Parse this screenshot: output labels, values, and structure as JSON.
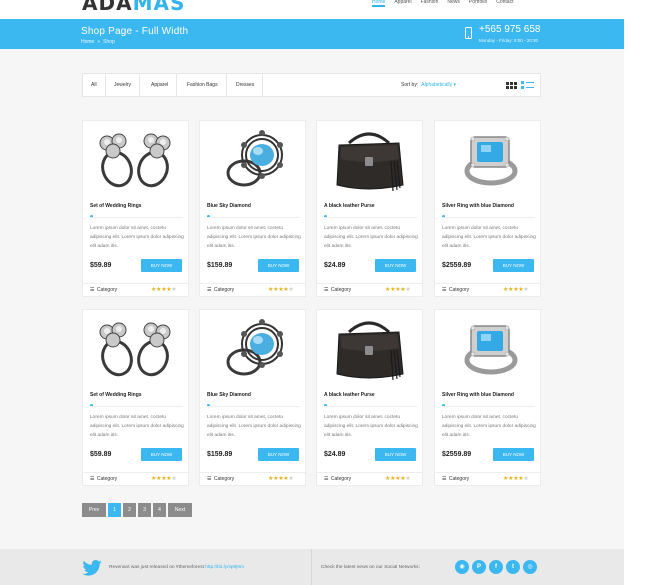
{
  "header": {
    "logo_main": "ADA",
    "logo_accent": "MAS",
    "nav": [
      "Home",
      "Apparel",
      "Fashion",
      "News",
      "Portfolio",
      "Contact"
    ]
  },
  "titlebar": {
    "title": "Shop Page - Full Width",
    "breadcrumb": [
      "Home",
      "Shop"
    ],
    "breadcrumb_sep": "»",
    "phone": "+565 975 658",
    "hours": "Monday - Friday: 8:00 - 20:30"
  },
  "filters": {
    "items": [
      "All",
      "Jewelry",
      "Apparel",
      "Fashion Bags",
      "Dresses"
    ],
    "sort_label": "Sort by:",
    "sort_value": "Alphabetically",
    "sort_caret": "▾"
  },
  "products": [
    {
      "name": "Set of Wedding Rings",
      "price": "$59.89",
      "image": "wedding-rings-image",
      "rating": 4
    },
    {
      "name": "Blue Sky Diamond",
      "price": "$159.89",
      "image": "blue-diamond-ring-image",
      "rating": 4
    },
    {
      "name": "A black leather Purse",
      "price": "$24.89",
      "image": "leather-purse-image",
      "rating": 4
    },
    {
      "name": "Silver Ring with blue Diamond",
      "price": "$2559.89",
      "image": "silver-ring-image",
      "rating": 4
    },
    {
      "name": "Set of Wedding Rings",
      "price": "$59.89",
      "image": "wedding-rings-image",
      "rating": 4
    },
    {
      "name": "Blue Sky Diamond",
      "price": "$159.89",
      "image": "blue-diamond-ring-image",
      "rating": 4
    },
    {
      "name": "A black leather Purse",
      "price": "$24.89",
      "image": "leather-purse-image",
      "rating": 4
    },
    {
      "name": "Silver Ring with blue Diamond",
      "price": "$2559.89",
      "image": "silver-ring-image",
      "rating": 4
    }
  ],
  "product_common": {
    "description": "Lorem ipsum dolor sit amet, coctetu adipiscing elit. Lorem ipsum dolor adipiscing elit adam itis.",
    "buy_label": "BUY NOW",
    "category_label": "Category",
    "rating_max": 5
  },
  "pagination": {
    "prev": "Prev",
    "pages": [
      "1",
      "2",
      "3",
      "4"
    ],
    "active_page": "1",
    "next": "Next"
  },
  "footer": {
    "tweet_text": "Revenant was just released on #themeforest",
    "tweet_link": "http://bit.ly/sp9j9m",
    "social_text": "Check the latest news on our Social Networks:",
    "social_icons": [
      "rss-icon",
      "pinterest-icon",
      "facebook-icon",
      "twitter-icon",
      "dribbble-icon"
    ],
    "social_glyphs": [
      "◉",
      "P",
      "f",
      "t",
      "◎"
    ]
  },
  "colors": {
    "accent": "#3cb8f0",
    "pagination_gray": "#8c8c8c",
    "star": "#e8b21a"
  }
}
